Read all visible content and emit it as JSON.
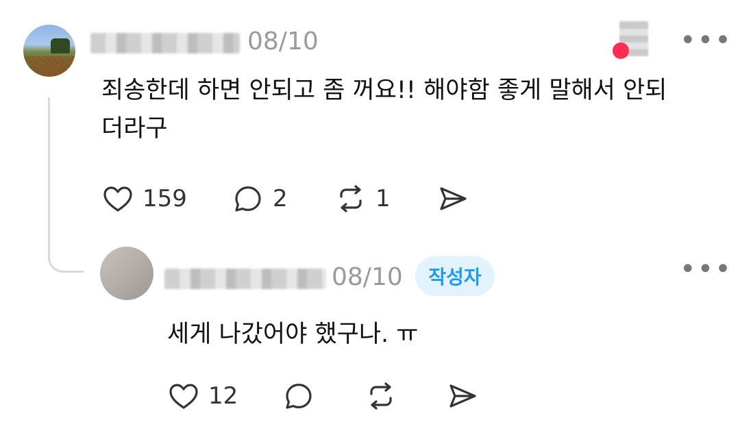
{
  "main_post": {
    "timestamp": "08/10",
    "text": "죄송한데 하면 안되고 좀 꺼요!! 해야함 좋게 말해서 안되더라구",
    "actions": {
      "like_count": "159",
      "reply_count": "2",
      "repost_count": "1"
    }
  },
  "reply_post": {
    "timestamp": "08/10",
    "author_badge": "작성자",
    "text": "세게 나갔어야 했구나. ㅠ",
    "actions": {
      "like_count": "12"
    }
  },
  "icons": {
    "like": "heart-icon",
    "reply": "comment-icon",
    "repost": "repost-icon",
    "share": "share-icon",
    "more": "more-options-icon"
  },
  "colors": {
    "badge_text": "#1d9bf0",
    "badge_bg": "#e3f3fd",
    "timestamp": "#9a9a9a",
    "icon": "#333333"
  }
}
